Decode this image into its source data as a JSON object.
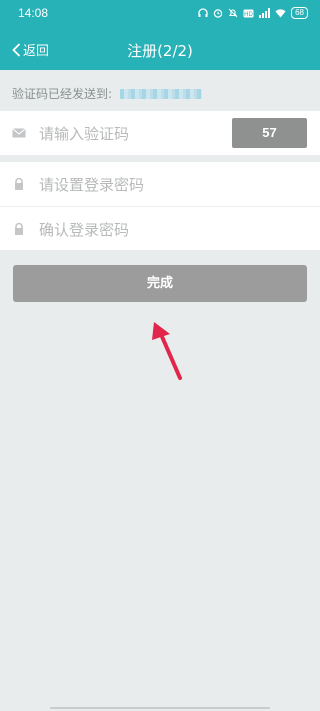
{
  "status_bar": {
    "time": "14:08",
    "battery": "68",
    "icons": [
      "headphones-icon",
      "alarm-icon",
      "bell-off-icon",
      "hd-icon",
      "signal-icon",
      "wifi-icon",
      "battery-icon"
    ]
  },
  "nav": {
    "back_label": "返回",
    "title": "注册(2/2)"
  },
  "form": {
    "sent_label": "验证码已经发送到:",
    "code_placeholder": "请输入验证码",
    "countdown": "57",
    "password_placeholder": "请设置登录密码",
    "confirm_placeholder": "确认登录密码"
  },
  "actions": {
    "submit_label": "完成"
  },
  "colors": {
    "header_bg": "#27b2b8",
    "page_bg": "#e8ecec",
    "button_bg": "#9c9c9c",
    "countdown_bg": "#8f9191",
    "arrow": "#e2254a"
  }
}
